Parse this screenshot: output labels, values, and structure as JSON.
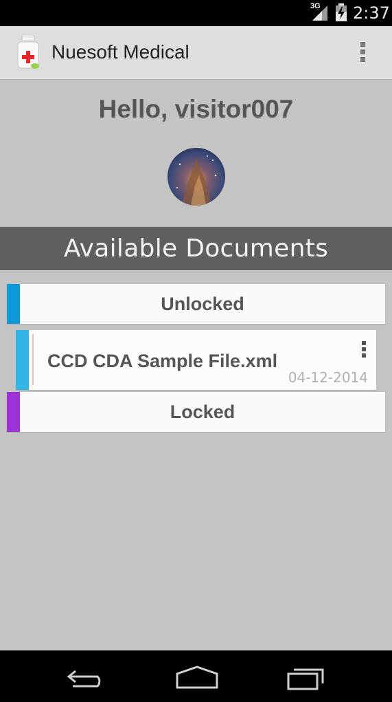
{
  "status_bar": {
    "network": "3G",
    "time": "2:37"
  },
  "action_bar": {
    "title": "Nuesoft Medical"
  },
  "greeting": "Hello, visitor007",
  "section_header": "Available Documents",
  "groups": [
    {
      "label": "Unlocked",
      "accent": "#0e9ad7",
      "documents": [
        {
          "name": "CCD CDA Sample File.xml",
          "date": "04-12-2014",
          "accent": "#33b5e5"
        }
      ]
    },
    {
      "label": "Locked",
      "accent": "#9b33d6",
      "documents": []
    }
  ],
  "icons": {
    "app": "medicine-bottle-icon",
    "overflow": "more-vert-icon",
    "back": "back-icon",
    "home": "home-icon",
    "recents": "recents-icon"
  }
}
